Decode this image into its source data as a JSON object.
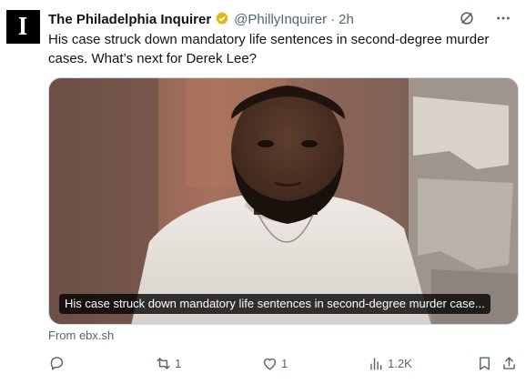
{
  "tweet": {
    "avatar_letter": "I",
    "author_name": "The Philadelphia Inquirer",
    "handle": "@PhillyInquirer",
    "separator": "·",
    "time": "2h",
    "text": "His case struck down mandatory life sentences in second-degree murder cases. What’s next for Derek Lee?",
    "media_caption": "His case struck down mandatory life sentences in second-degree murder case...",
    "source": "From ebx.sh"
  },
  "actions": {
    "replies": "",
    "reposts": "1",
    "likes": "1",
    "views": "1.2K"
  },
  "colors": {
    "verified_badge": "#e2b719",
    "secondary_text": "#536471"
  }
}
